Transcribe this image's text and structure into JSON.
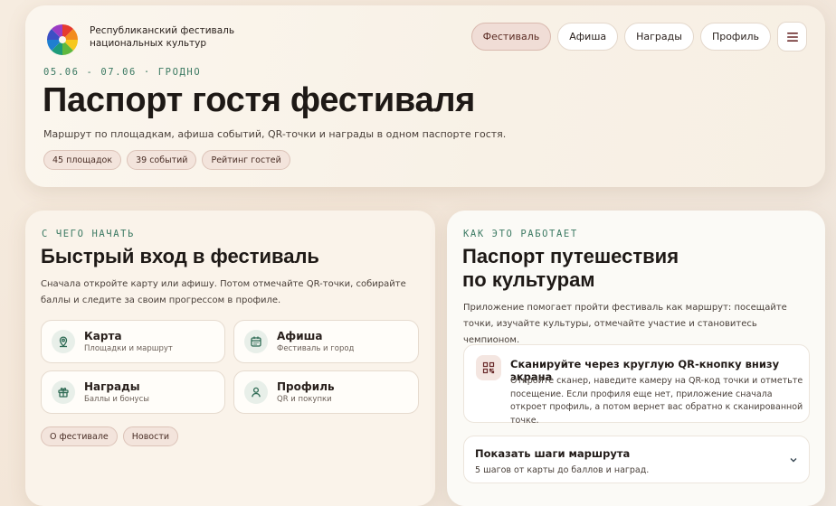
{
  "header": {
    "brand_name": "Республиканский фестиваль национальных культур",
    "nav": [
      {
        "label": "Фестиваль",
        "active": true
      },
      {
        "label": "Афиша",
        "active": false
      },
      {
        "label": "Награды",
        "active": false
      },
      {
        "label": "Профиль",
        "active": false
      }
    ],
    "menu_icon": "hamburger-icon"
  },
  "hero": {
    "eyebrow": "05.06 - 07.06 · ГРОДНО",
    "title": "Паспорт гостя фестиваля",
    "subtitle": "Маршрут по площадкам, афиша событий, QR-точки и награды в одном паспорте гостя.",
    "chips": [
      "45 площадок",
      "39 событий",
      "Рейтинг гостей"
    ]
  },
  "quick_start": {
    "eyebrow": "С ЧЕГО НАЧАТЬ",
    "title": "Быстрый вход в фестиваль",
    "description": "Сначала откройте карту или афишу. Потом отмечайте QR-точки, собирайте баллы и следите за своим прогрессом в профиле.",
    "items": [
      {
        "label": "Карта",
        "sub": "Площадки и маршрут",
        "icon": "map-pin-icon"
      },
      {
        "label": "Афиша",
        "sub": "Фестиваль и город",
        "icon": "calendar-icon"
      },
      {
        "label": "Награды",
        "sub": "Баллы и бонусы",
        "icon": "gift-icon"
      },
      {
        "label": "Профиль",
        "sub": "QR и покупки",
        "icon": "user-icon"
      }
    ],
    "chips": [
      "О фестивале",
      "Новости"
    ]
  },
  "how_it_works": {
    "eyebrow": "КАК ЭТО РАБОТАЕТ",
    "title_line1": "Паспорт путешествия",
    "title_line2": "по культурам",
    "description": "Приложение помогает пройти фестиваль как маршрут: посещайте точки, изучайте культуры, отмечайте участие и становитесь чемпионом.",
    "scan": {
      "icon": "qr-code-icon",
      "title": "Сканируйте через круглую QR-кнопку внизу экрана",
      "body": "Откройте сканер, наведите камеру на QR-код точки и отметьте посещение. Если профиля еще нет, приложение сначала откроет профиль, а потом вернет вас обратно к сканированной точке."
    },
    "steps": {
      "title": "Показать шаги маршрута",
      "sub": "5 шагов от карты до баллов и наград.",
      "icon": "chevron-down-icon"
    }
  },
  "colors": {
    "accent_green": "#3c7a63",
    "accent_rose": "#f0ddd6",
    "background": "#f5ebe0"
  }
}
